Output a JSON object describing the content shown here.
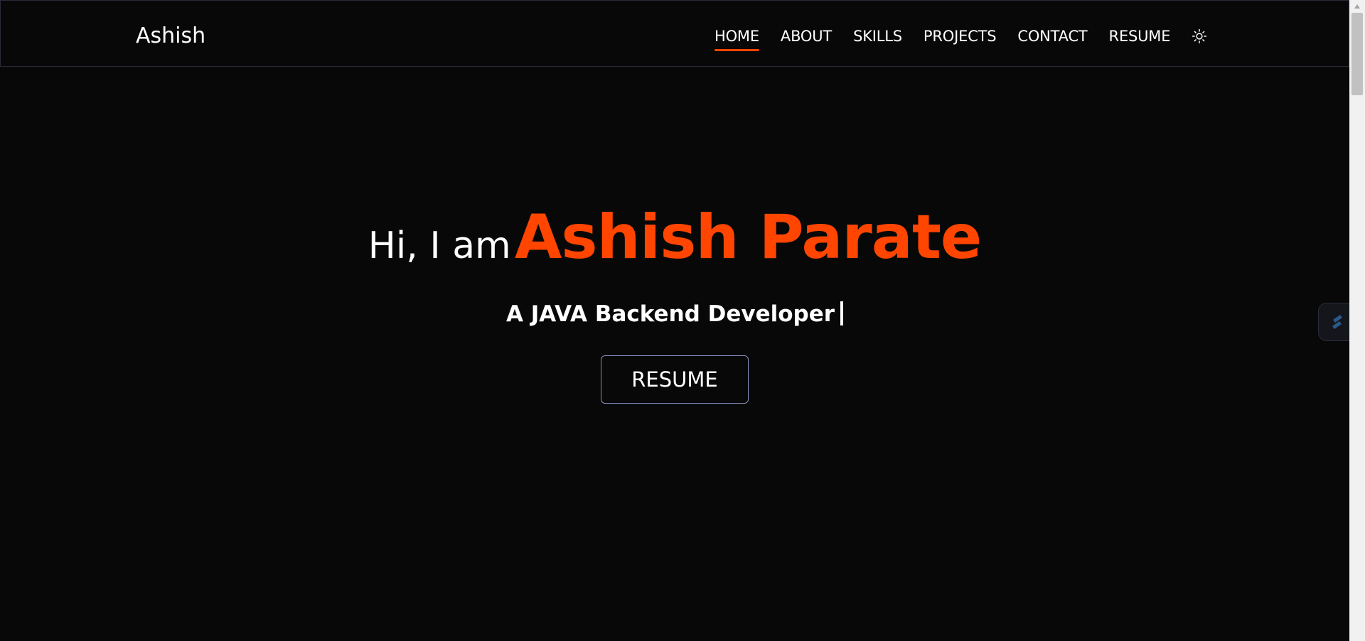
{
  "brand": {
    "name": "Ashish"
  },
  "nav": {
    "items": [
      {
        "label": "HOME",
        "active": true
      },
      {
        "label": "ABOUT",
        "active": false
      },
      {
        "label": "SKILLS",
        "active": false
      },
      {
        "label": "PROJECTS",
        "active": false
      },
      {
        "label": "CONTACT",
        "active": false
      },
      {
        "label": "RESUME",
        "active": false
      }
    ],
    "theme_toggle_icon": "sun-icon"
  },
  "hero": {
    "greeting": "Hi, I am",
    "name": "Ashish Parate",
    "role": "A JAVA Backend Developer",
    "button_label": "RESUME"
  },
  "colors": {
    "background": "#080808",
    "accent": "#ff4500",
    "text": "#ffffff",
    "button_border": "#8a8fc0"
  },
  "floating_widget": {
    "icon": "extension-icon"
  }
}
